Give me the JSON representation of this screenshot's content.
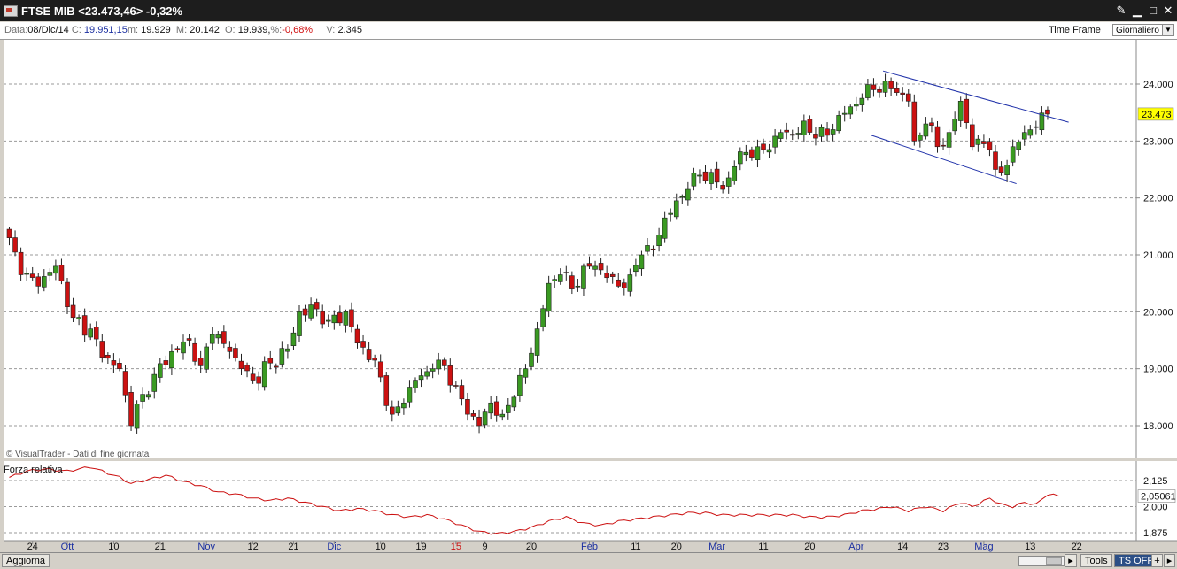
{
  "window": {
    "title": "FTSE MIB <23.473,46> -0,32%",
    "tool_icon": "wrench-icon",
    "min_glyph": "▁",
    "max_glyph": "□",
    "close_glyph": "✕"
  },
  "infobar": {
    "data_label": "Data:",
    "date": "08/Dic/14",
    "c_label": "C:",
    "close": "19.951,15",
    "m_label": "m:",
    "low": "19.929",
    "M_label": "M:",
    "high": "20.142",
    "o_label": "O:",
    "open": "19.939,",
    "pct_sep": "%:",
    "pct": "-0,68%",
    "v_label": "V:",
    "volume": "2.345",
    "timeframe_label": "Time Frame",
    "timeframe_value": "Giornaliero"
  },
  "colors": {
    "up": "#3a9a22",
    "down": "#cc1111",
    "rsi_line": "#cc1111",
    "channel": "#2233aa",
    "current_price_bg": "#ffff00",
    "blue_label": "#1b2fa0"
  },
  "chart_data": {
    "type": "candlestick",
    "watermark": "© VisualTrader - Dati di fine giornata",
    "y_ticks": [
      "24.000",
      "23.000",
      "22.000",
      "21.000",
      "20.000",
      "19.000",
      "18.000"
    ],
    "y_tick_values": [
      24000,
      23000,
      22000,
      21000,
      20000,
      19000,
      18000
    ],
    "current_price_label": "23.473",
    "current_price": 23473,
    "x_labels": [
      {
        "label": "24",
        "idx": 4,
        "color": "#111111"
      },
      {
        "label": "Ott",
        "idx": 10,
        "color": "#1b2fa0"
      },
      {
        "label": "10",
        "idx": 18,
        "color": "#111111"
      },
      {
        "label": "21",
        "idx": 26,
        "color": "#111111"
      },
      {
        "label": "Nov",
        "idx": 34,
        "color": "#1b2fa0"
      },
      {
        "label": "12",
        "idx": 42,
        "color": "#111111"
      },
      {
        "label": "21",
        "idx": 49,
        "color": "#111111"
      },
      {
        "label": "Dic",
        "idx": 56,
        "color": "#1b2fa0"
      },
      {
        "label": "10",
        "idx": 64,
        "color": "#111111"
      },
      {
        "label": "19",
        "idx": 71,
        "color": "#111111"
      },
      {
        "label": "15",
        "idx": 77,
        "color": "#cc1111"
      },
      {
        "label": "9",
        "idx": 82,
        "color": "#111111"
      },
      {
        "label": "20",
        "idx": 90,
        "color": "#111111"
      },
      {
        "label": "Feb",
        "idx": 100,
        "color": "#1b2fa0"
      },
      {
        "label": "11",
        "idx": 108,
        "color": "#111111"
      },
      {
        "label": "20",
        "idx": 115,
        "color": "#111111"
      },
      {
        "label": "Mar",
        "idx": 122,
        "color": "#1b2fa0"
      },
      {
        "label": "11",
        "idx": 130,
        "color": "#111111"
      },
      {
        "label": "20",
        "idx": 138,
        "color": "#111111"
      },
      {
        "label": "Apr",
        "idx": 146,
        "color": "#1b2fa0"
      },
      {
        "label": "14",
        "idx": 154,
        "color": "#111111"
      },
      {
        "label": "23",
        "idx": 161,
        "color": "#111111"
      },
      {
        "label": "Mag",
        "idx": 168,
        "color": "#1b2fa0"
      },
      {
        "label": "13",
        "idx": 176,
        "color": "#111111"
      },
      {
        "label": "22",
        "idx": 184,
        "color": "#111111"
      }
    ],
    "key_closes": [
      [
        0,
        21300
      ],
      [
        2,
        20650
      ],
      [
        5,
        20450
      ],
      [
        8,
        20800
      ],
      [
        11,
        19900
      ],
      [
        14,
        19700
      ],
      [
        16,
        19200
      ],
      [
        19,
        19000
      ],
      [
        21,
        18000
      ],
      [
        23,
        18550
      ],
      [
        25,
        18900
      ],
      [
        28,
        19300
      ],
      [
        31,
        19500
      ],
      [
        33,
        19050
      ],
      [
        35,
        19600
      ],
      [
        38,
        19300
      ],
      [
        40,
        19000
      ],
      [
        42,
        18800
      ],
      [
        45,
        19100
      ],
      [
        48,
        19350
      ],
      [
        50,
        20000
      ],
      [
        53,
        20050
      ],
      [
        55,
        19850
      ],
      [
        58,
        20000
      ],
      [
        60,
        19450
      ],
      [
        63,
        19150
      ],
      [
        66,
        18200
      ],
      [
        68,
        18400
      ],
      [
        70,
        18800
      ],
      [
        73,
        19000
      ],
      [
        75,
        19050
      ],
      [
        77,
        18700
      ],
      [
        79,
        18200
      ],
      [
        81,
        18000
      ],
      [
        83,
        18400
      ],
      [
        85,
        18200
      ],
      [
        87,
        18500
      ],
      [
        89,
        19000
      ],
      [
        91,
        19700
      ],
      [
        93,
        20500
      ],
      [
        95,
        20650
      ],
      [
        97,
        20400
      ],
      [
        99,
        20800
      ],
      [
        101,
        20800
      ],
      [
        103,
        20600
      ],
      [
        105,
        20450
      ],
      [
        107,
        20650
      ],
      [
        109,
        21000
      ],
      [
        111,
        21100
      ],
      [
        113,
        21650
      ],
      [
        115,
        21950
      ],
      [
        117,
        22150
      ],
      [
        119,
        22400
      ],
      [
        121,
        22450
      ],
      [
        123,
        22150
      ],
      [
        125,
        22550
      ],
      [
        127,
        22800
      ],
      [
        129,
        22900
      ],
      [
        131,
        22850
      ],
      [
        133,
        23150
      ],
      [
        135,
        23100
      ],
      [
        137,
        23350
      ],
      [
        139,
        23050
      ],
      [
        141,
        23100
      ],
      [
        143,
        23450
      ],
      [
        145,
        23600
      ],
      [
        147,
        23750
      ],
      [
        149,
        23900
      ],
      [
        151,
        24050
      ],
      [
        153,
        23850
      ],
      [
        155,
        23700
      ],
      [
        156,
        23000
      ],
      [
        158,
        23300
      ],
      [
        160,
        22900
      ],
      [
        162,
        23150
      ],
      [
        164,
        23700
      ],
      [
        166,
        22900
      ],
      [
        168,
        22950
      ],
      [
        169,
        22850
      ],
      [
        170,
        22500
      ],
      [
        171,
        22450
      ],
      [
        173,
        22900
      ],
      [
        175,
        23150
      ],
      [
        177,
        23250
      ],
      [
        179,
        23473
      ]
    ],
    "channel_upper": [
      [
        151,
        24230
      ],
      [
        183,
        23330
      ]
    ],
    "channel_lower": [
      [
        149,
        23100
      ],
      [
        174,
        22250
      ]
    ],
    "rsi": {
      "label": "Forza relativa",
      "y_ticks": [
        "2,125",
        "2,000",
        "1,875"
      ],
      "y_tick_values": [
        2.125,
        2.0,
        1.875
      ],
      "current_label": "2,05061",
      "current": 2.05061,
      "key_values": [
        [
          0,
          2.14
        ],
        [
          3,
          2.17
        ],
        [
          6,
          2.18
        ],
        [
          10,
          2.17
        ],
        [
          14,
          2.19
        ],
        [
          17,
          2.16
        ],
        [
          19,
          2.14
        ],
        [
          21,
          2.11
        ],
        [
          24,
          2.13
        ],
        [
          27,
          2.15
        ],
        [
          30,
          2.12
        ],
        [
          33,
          2.1
        ],
        [
          36,
          2.07
        ],
        [
          39,
          2.06
        ],
        [
          42,
          2.04
        ],
        [
          45,
          2.03
        ],
        [
          48,
          2.04
        ],
        [
          51,
          2.02
        ],
        [
          54,
          2.0
        ],
        [
          57,
          1.98
        ],
        [
          60,
          1.99
        ],
        [
          63,
          1.98
        ],
        [
          66,
          1.96
        ],
        [
          69,
          1.95
        ],
        [
          72,
          1.96
        ],
        [
          75,
          1.94
        ],
        [
          78,
          1.91
        ],
        [
          81,
          1.88
        ],
        [
          84,
          1.87
        ],
        [
          87,
          1.88
        ],
        [
          90,
          1.9
        ],
        [
          93,
          1.93
        ],
        [
          96,
          1.95
        ],
        [
          99,
          1.92
        ],
        [
          102,
          1.91
        ],
        [
          105,
          1.93
        ],
        [
          108,
          1.94
        ],
        [
          111,
          1.95
        ],
        [
          114,
          1.96
        ],
        [
          117,
          1.97
        ],
        [
          120,
          1.97
        ],
        [
          123,
          1.96
        ],
        [
          126,
          1.96
        ],
        [
          129,
          1.96
        ],
        [
          132,
          1.96
        ],
        [
          135,
          1.96
        ],
        [
          138,
          1.95
        ],
        [
          141,
          1.95
        ],
        [
          144,
          1.96
        ],
        [
          147,
          1.98
        ],
        [
          150,
          1.99
        ],
        [
          152,
          2.0
        ],
        [
          155,
          1.98
        ],
        [
          158,
          2.0
        ],
        [
          161,
          1.98
        ],
        [
          164,
          2.02
        ],
        [
          166,
          2.0
        ],
        [
          169,
          2.04
        ],
        [
          171,
          2.01
        ],
        [
          173,
          2.0
        ],
        [
          175,
          2.02
        ],
        [
          177,
          2.01
        ],
        [
          179,
          2.06
        ],
        [
          181,
          2.05
        ]
      ]
    }
  },
  "bottombar": {
    "refresh_label": "Aggiorna",
    "tools_label": "Tools",
    "ts_label": "TS OFF",
    "plus_label": "+",
    "right_arrow": "▸"
  }
}
